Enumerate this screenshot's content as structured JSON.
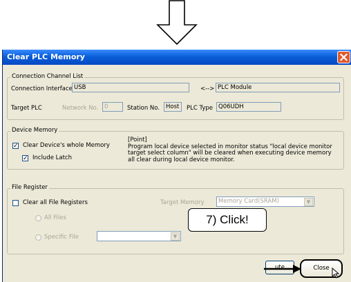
{
  "window": {
    "title": "Clear PLC Memory"
  },
  "connection": {
    "group_label": "Connection Channel List",
    "interface_label": "Connection Interface",
    "interface_value": "USB",
    "arrow_text": "<-->",
    "target_value": "PLC Module",
    "target_plc_label": "Target PLC",
    "network_label": "Network No.",
    "network_value": "0",
    "station_label": "Station No.",
    "station_value": "Host",
    "plc_type_label": "PLC Type",
    "plc_type_value": "Q06UDH"
  },
  "device_memory": {
    "group_label": "Device Memory",
    "clear_all_label": "Clear Device's whole Memory",
    "clear_all_checked": true,
    "include_latch_label": "Include Latch",
    "include_latch_checked": true,
    "point_title": "[Point]",
    "point_line1": "Program local device selected in monitor status \"local device monitor",
    "point_line2": "target select column\" will be cleared when executing device memory",
    "point_line3": "all clear during local device monitor."
  },
  "file_register": {
    "group_label": "File Register",
    "clear_all_label": "Clear all File Registers",
    "clear_all_checked": false,
    "target_memory_label": "Target Memory",
    "target_memory_value": "Memory Card(SRAM)",
    "all_files_label": "All Files",
    "specific_file_label": "Specific File",
    "specific_file_value": ""
  },
  "buttons": {
    "execute_partial": "ute",
    "close_label": "Close"
  },
  "annotation": {
    "text": "7) Click!"
  },
  "icons": [
    "down-arrow-icon",
    "close-icon",
    "checkmark-icon",
    "dropdown-arrow-icon",
    "mouse-cursor-icon"
  ]
}
